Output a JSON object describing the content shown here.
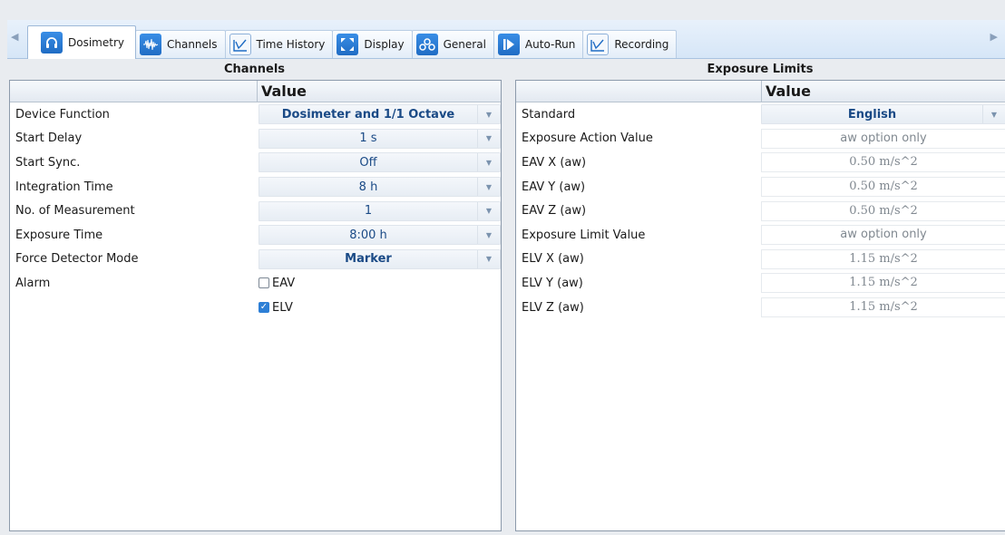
{
  "tabs": [
    {
      "label": "Dosimetry",
      "icon": "headphones-icon",
      "active": true
    },
    {
      "label": "Channels",
      "icon": "waveform-icon",
      "active": false
    },
    {
      "label": "Time History",
      "icon": "line-chart-icon",
      "active": false
    },
    {
      "label": "Display",
      "icon": "expand-arrows-icon",
      "active": false
    },
    {
      "label": "General",
      "icon": "gears-icon",
      "active": false
    },
    {
      "label": "Auto-Run",
      "icon": "play-icon",
      "active": false
    },
    {
      "label": "Recording",
      "icon": "line-chart-icon",
      "active": false
    }
  ],
  "channels": {
    "title": "Channels",
    "value_header": "Value",
    "rows": [
      {
        "name": "Device Function",
        "value": "Dosimeter and 1/1 Octave"
      },
      {
        "name": "Start Delay",
        "value": "1 s"
      },
      {
        "name": "Start Sync.",
        "value": "Off"
      },
      {
        "name": "Integration Time",
        "value": "8 h"
      },
      {
        "name": "No. of Measurement",
        "value": "1"
      },
      {
        "name": "Exposure Time",
        "value": "8:00 h"
      },
      {
        "name": "Force Detector Mode",
        "value": "Marker"
      }
    ],
    "alarm": {
      "name": "Alarm",
      "options": [
        {
          "label": "EAV",
          "checked": false
        },
        {
          "label": "ELV",
          "checked": true
        }
      ]
    }
  },
  "exposure": {
    "title": "Exposure Limits",
    "value_header": "Value",
    "standard": {
      "name": "Standard",
      "value": "English"
    },
    "rows": [
      {
        "name": "Exposure Action Value",
        "value": "aw option only"
      },
      {
        "name": "EAV X (aw)",
        "value": "0.50 m/s^2"
      },
      {
        "name": "EAV Y (aw)",
        "value": "0.50 m/s^2"
      },
      {
        "name": "EAV Z (aw)",
        "value": "0.50 m/s^2"
      },
      {
        "name": "Exposure Limit Value",
        "value": "aw option only"
      },
      {
        "name": "ELV X (aw)",
        "value": "1.15 m/s^2"
      },
      {
        "name": "ELV Y (aw)",
        "value": "1.15 m/s^2"
      },
      {
        "name": "ELV Z (aw)",
        "value": "1.15 m/s^2"
      }
    ]
  },
  "colors": {
    "accent": "#2d7fd6",
    "value_text": "#1a4a86",
    "readonly_text": "#808890"
  }
}
